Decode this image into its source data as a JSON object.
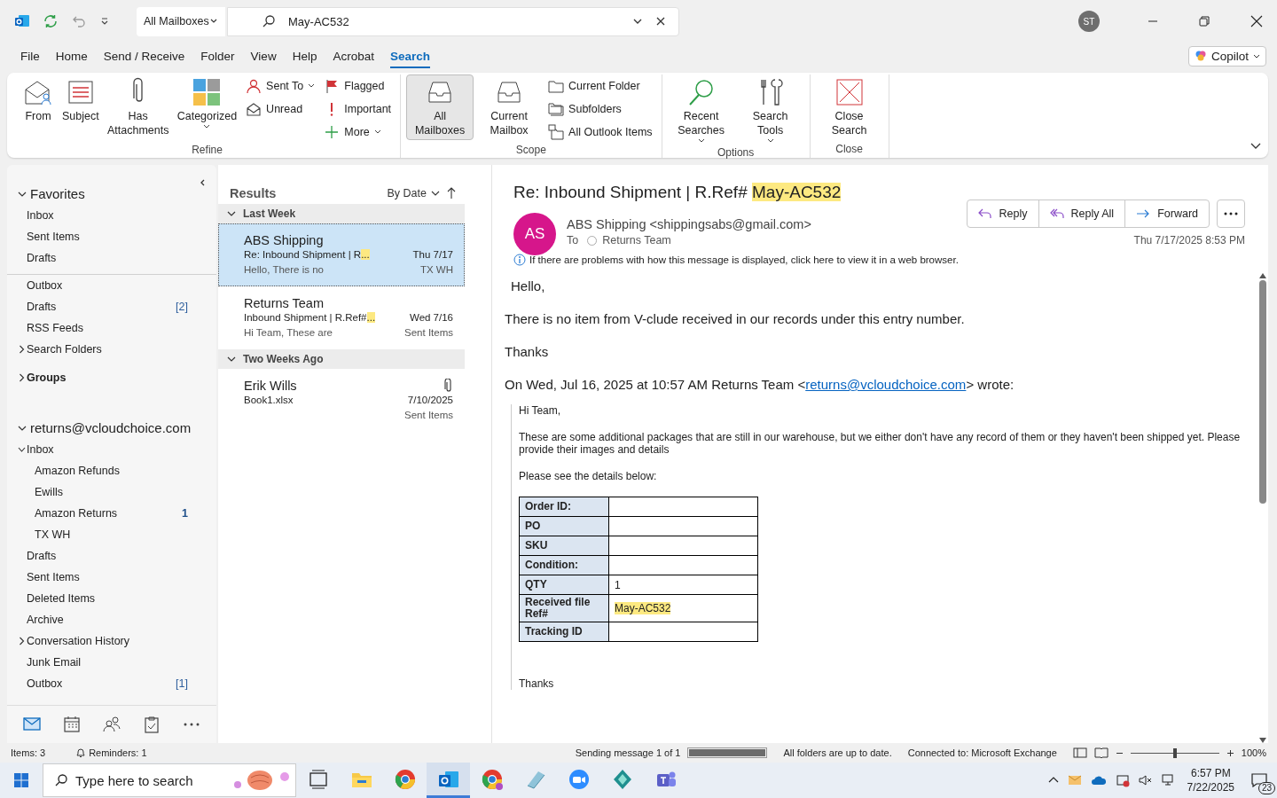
{
  "titlebar": {
    "scope": "All Mailboxes",
    "search_value": "May-AC532",
    "avatar": "ST"
  },
  "menu_tabs": [
    {
      "label": "File",
      "selected": false
    },
    {
      "label": "Home",
      "selected": false
    },
    {
      "label": "Send / Receive",
      "selected": false
    },
    {
      "label": "Folder",
      "selected": false
    },
    {
      "label": "View",
      "selected": false
    },
    {
      "label": "Help",
      "selected": false
    },
    {
      "label": "Acrobat",
      "selected": false
    },
    {
      "label": "Search",
      "selected": true
    }
  ],
  "copilot": "Copilot",
  "ribbon": [
    {
      "label": "Refine",
      "large": [
        {
          "label": "From",
          "menu": false,
          "selected": false
        },
        {
          "label": "Subject",
          "menu": false,
          "selected": false
        },
        {
          "label": "Has Attachments",
          "menu": false,
          "selected": false
        },
        {
          "label": "Categorized",
          "menu": true,
          "selected": false
        }
      ],
      "columns": [
        [
          {
            "label": "Sent To",
            "menu": true
          },
          {
            "label": "Unread",
            "menu": false
          }
        ],
        [
          {
            "label": "Flagged",
            "menu": false
          },
          {
            "label": "Important",
            "menu": false
          },
          {
            "label": "More",
            "menu": true
          }
        ]
      ]
    },
    {
      "label": "Scope",
      "large": [
        {
          "label": "All Mailboxes",
          "menu": false,
          "selected": true
        },
        {
          "label": "Current Mailbox",
          "menu": false,
          "selected": false
        }
      ],
      "columns": [
        [
          {
            "label": "Current Folder",
            "menu": false
          },
          {
            "label": "Subfolders",
            "menu": false
          },
          {
            "label": "All Outlook Items",
            "menu": false
          }
        ]
      ]
    },
    {
      "label": "Options",
      "large": [
        {
          "label": "Recent Searches",
          "menu": true,
          "selected": false
        },
        {
          "label": "Search Tools",
          "menu": true,
          "selected": false
        }
      ]
    },
    {
      "label": "Close",
      "large": [
        {
          "label": "Close Search",
          "menu": false,
          "selected": false
        }
      ]
    }
  ],
  "sidebar": {
    "favorites": {
      "title": "Favorites",
      "expanded": true,
      "items": [
        {
          "label": "Inbox"
        },
        {
          "label": "Sent Items"
        },
        {
          "label": "Drafts"
        }
      ]
    },
    "folders": [
      {
        "label": "Outbox"
      },
      {
        "label": "Drafts",
        "count": "[2]",
        "unread": false
      },
      {
        "label": "RSS Feeds"
      },
      {
        "label": "Search Folders",
        "expanded": false
      }
    ],
    "groups": {
      "label": "Groups",
      "expanded": false
    },
    "account": {
      "title": "returns@vcloudchoice.com",
      "expanded": true,
      "folders": [
        {
          "label": "Inbox",
          "expanded": true,
          "children": [
            {
              "label": "Amazon Refunds"
            },
            {
              "label": "Ewills"
            },
            {
              "label": "Amazon Returns",
              "count": "1",
              "unread": true
            },
            {
              "label": "TX WH"
            }
          ]
        },
        {
          "label": "Drafts"
        },
        {
          "label": "Sent Items"
        },
        {
          "label": "Deleted Items"
        },
        {
          "label": "Archive"
        },
        {
          "label": "Conversation History",
          "expanded": false
        },
        {
          "label": "Junk Email"
        },
        {
          "label": "Outbox",
          "count": "[1]",
          "unread": false
        }
      ]
    },
    "nav": [
      {
        "selected": true
      },
      {
        "selected": false
      },
      {
        "selected": false
      },
      {
        "selected": false
      },
      {
        "selected": false
      }
    ]
  },
  "results": {
    "title": "Results",
    "sort": "By Date",
    "groups": [
      {
        "label": "Last Week",
        "expanded": true,
        "messages": [
          {
            "sender": "ABS Shipping",
            "subject": "Re: Inbound Shipment | R",
            "highlight": "...",
            "preview": "Hello,  There is no",
            "date": "Thu 7/17",
            "folder": "TX WH",
            "selected": true,
            "attachment": false
          },
          {
            "sender": "Returns Team",
            "subject": "Inbound Shipment | R.Ref#",
            "highlight": "...",
            "preview": "Hi Team,  These are",
            "date": "Wed 7/16",
            "folder": "Sent Items",
            "selected": false,
            "attachment": false
          }
        ]
      },
      {
        "label": "Two Weeks Ago",
        "expanded": true,
        "messages": [
          {
            "sender": "Erik Wills",
            "subject": "Book1.xlsx",
            "date": "7/10/2025",
            "folder": "Sent Items",
            "selected": false,
            "attachment": true
          }
        ]
      }
    ]
  },
  "message": {
    "subject": "Re: Inbound Shipment | R.Ref#",
    "subject_highlight": "May-AC532",
    "avatar": "AS",
    "from": "ABS Shipping <shippingsabs@gmail.com>",
    "to_label": "To",
    "to": "Returns Team",
    "date": "Thu 7/17/2025 8:53 PM",
    "actions": [
      {
        "label": "Reply"
      },
      {
        "label": "Reply All"
      },
      {
        "label": "Forward"
      }
    ],
    "info": "If there are problems with how this message is displayed, click here to view it in a web browser.",
    "greeting": "Hello,",
    "body": "There is no item from V-clude received in our records under this entry number.",
    "closing": "Thanks",
    "quote_intro": "On Wed, Jul 16, 2025 at 10:57 AM Returns Team <",
    "quote_link": "returns@vcloudchoice.com",
    "quote_outro": "> wrote:",
    "quoted": {
      "greeting": "Hi Team,",
      "body": "These are some additional packages that are still in our warehouse, but we either don't have any record of them or they haven't been shipped yet. Please provide their images and details",
      "details_intro": "Please see the details below:",
      "table": [
        {
          "label": "Order ID:"
        },
        {
          "label": "PO"
        },
        {
          "label": "SKU"
        },
        {
          "label": "Condition:"
        },
        {
          "label": "QTY",
          "value": "1",
          "highlight": false
        },
        {
          "label": "Received file Ref#",
          "value": "May-AC532",
          "highlight": true
        },
        {
          "label": "Tracking ID"
        }
      ],
      "closing": "Thanks"
    }
  },
  "status_bar": {
    "items": "Items: 3",
    "reminders": "Reminders: 1",
    "sending": "Sending message 1 of 1",
    "sending_progress": {
      "level": 1
    },
    "sync": "All folders are up to date.",
    "connection": "Connected to: Microsoft Exchange",
    "zoom_slider": {
      "level": 0.5
    },
    "zoom": "100%"
  },
  "taskbar": {
    "search_placeholder": "Type here to search",
    "apps": [
      {
        "selected": false
      },
      {
        "selected": false
      },
      {
        "selected": false
      },
      {
        "selected": true
      },
      {
        "selected": false
      },
      {
        "selected": false
      },
      {
        "selected": false
      },
      {
        "selected": false
      },
      {
        "selected": false
      }
    ],
    "time": "6:57 PM",
    "date": "7/22/2025",
    "notifications": "23"
  }
}
